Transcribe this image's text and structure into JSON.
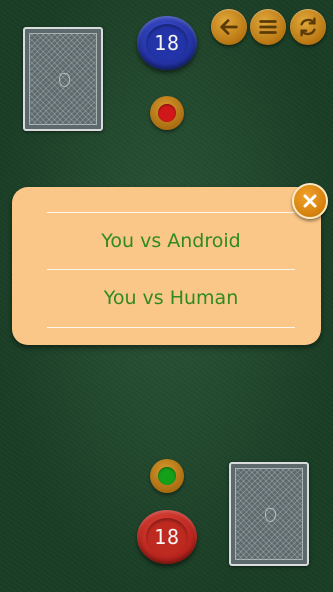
{
  "toolbar": {
    "back_icon": "arrow-left-icon",
    "menu_icon": "hamburger-menu-icon",
    "restart_icon": "refresh-icon"
  },
  "opponent": {
    "score": "18",
    "chip_color": "#2334a8",
    "indicator_color": "#d0181a"
  },
  "player": {
    "score": "18",
    "chip_color": "#bf2a20",
    "indicator_color": "#15a019"
  },
  "mode_dialog": {
    "options": [
      {
        "label": "You vs Android"
      },
      {
        "label": "You vs Human"
      }
    ],
    "close_icon": "close-icon",
    "background_color": "#fac788",
    "text_color": "#2f8a22"
  },
  "colors": {
    "felt": "#1e4a2c",
    "button_orange": "#c98b1f"
  }
}
